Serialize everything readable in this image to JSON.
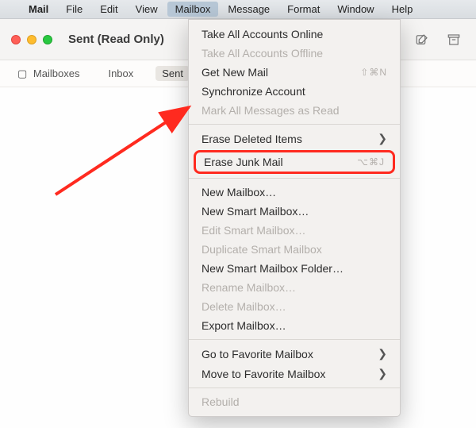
{
  "menubar": {
    "items": [
      "Mail",
      "File",
      "Edit",
      "View",
      "Mailbox",
      "Message",
      "Format",
      "Window",
      "Help"
    ],
    "active_index": 4
  },
  "window": {
    "title": "Sent (Read Only)"
  },
  "favorites": {
    "mailboxes_label": "Mailboxes",
    "items": [
      "Inbox",
      "Sent"
    ],
    "active_index": 1
  },
  "menu": {
    "groups": [
      [
        {
          "label": "Take All Accounts Online",
          "disabled": false
        },
        {
          "label": "Take All Accounts Offline",
          "disabled": true
        },
        {
          "label": "Get New Mail",
          "disabled": false,
          "shortcut": "⇧⌘N"
        },
        {
          "label": "Synchronize Account",
          "disabled": false
        },
        {
          "label": "Mark All Messages as Read",
          "disabled": true
        }
      ],
      [
        {
          "label": "Erase Deleted Items",
          "disabled": false,
          "submenu": true
        },
        {
          "label": "Erase Junk Mail",
          "disabled": false,
          "shortcut": "⌥⌘J",
          "highlight": true
        }
      ],
      [
        {
          "label": "New Mailbox…",
          "disabled": false
        },
        {
          "label": "New Smart Mailbox…",
          "disabled": false
        },
        {
          "label": "Edit Smart Mailbox…",
          "disabled": true
        },
        {
          "label": "Duplicate Smart Mailbox",
          "disabled": true
        },
        {
          "label": "New Smart Mailbox Folder…",
          "disabled": false
        },
        {
          "label": "Rename Mailbox…",
          "disabled": true
        },
        {
          "label": "Delete Mailbox…",
          "disabled": true
        },
        {
          "label": "Export Mailbox…",
          "disabled": false
        }
      ],
      [
        {
          "label": "Go to Favorite Mailbox",
          "disabled": false,
          "submenu": true
        },
        {
          "label": "Move to Favorite Mailbox",
          "disabled": false,
          "submenu": true
        }
      ],
      [
        {
          "label": "Rebuild",
          "disabled": true
        }
      ]
    ]
  }
}
